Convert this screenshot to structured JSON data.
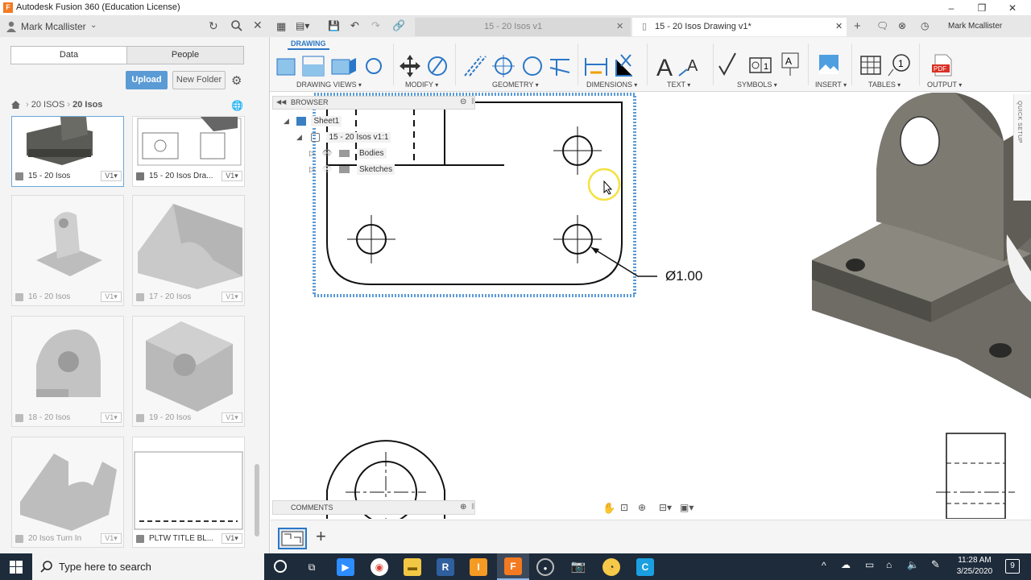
{
  "window": {
    "title": "Autodesk Fusion 360 (Education License)"
  },
  "user": {
    "name": "Mark Mcallister"
  },
  "left_panel": {
    "tabs": [
      "Data",
      "People"
    ],
    "upload_label": "Upload",
    "new_folder_label": "New Folder",
    "breadcrumb": [
      "20 ISOS",
      "20 Isos"
    ],
    "cards": [
      {
        "name": "15 - 20 Isos",
        "version": "V1▾"
      },
      {
        "name": "15 - 20 Isos Dra...",
        "version": "V1▾"
      },
      {
        "name": "16 - 20 Isos",
        "version": "V1▾"
      },
      {
        "name": "17 - 20 Isos",
        "version": "V1▾"
      },
      {
        "name": "18 - 20 Isos",
        "version": "V1▾"
      },
      {
        "name": "19 - 20 Isos",
        "version": "V1▾"
      },
      {
        "name": "20 Isos Turn In",
        "version": "V1▾"
      },
      {
        "name": "PLTW TITLE BL...",
        "version": "V1▾"
      }
    ]
  },
  "tabs": [
    {
      "label": "15 - 20 Isos v1"
    },
    {
      "label": "15 - 20 Isos Drawing v1*"
    }
  ],
  "ribbon": {
    "workspace_tab": "DRAWING",
    "groups": [
      "DRAWING VIEWS",
      "MODIFY",
      "GEOMETRY",
      "DIMENSIONS",
      "TEXT",
      "SYMBOLS",
      "INSERT",
      "TABLES",
      "OUTPUT"
    ]
  },
  "browser": {
    "title": "BROWSER",
    "sheet": "Sheet1",
    "component": "15 - 20 Isos v1:1",
    "items": [
      "Bodies",
      "Sketches"
    ]
  },
  "drawing": {
    "dimension": "Ø1.00"
  },
  "quick_setup": "QUICK SETUP",
  "comments": {
    "title": "COMMENTS"
  },
  "taskbar": {
    "search_placeholder": "Type here to search",
    "time": "11:28 AM",
    "date": "3/25/2020",
    "notifications": "9"
  }
}
